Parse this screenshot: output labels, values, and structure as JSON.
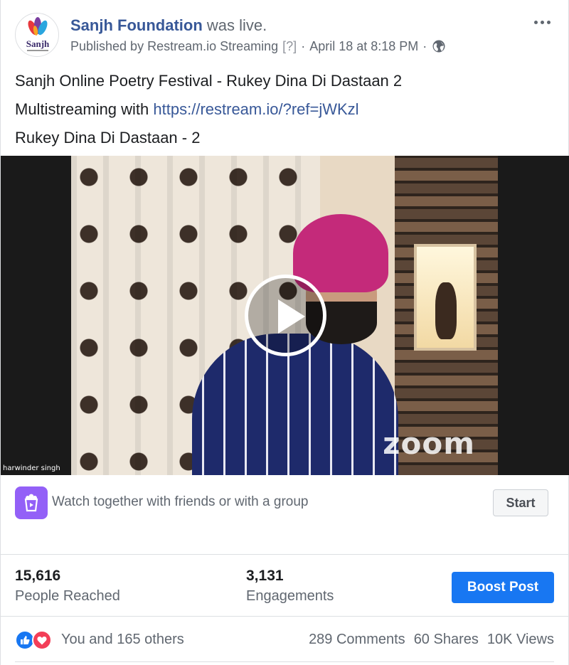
{
  "header": {
    "page_name": "Sanjh Foundation",
    "action": "was live.",
    "published_by": "Published by",
    "publisher_app": "Restream.io Streaming",
    "help": "[?]",
    "timestamp": "April 18 at 8:18 PM",
    "avatar_text": "Sanjh",
    "privacy_icon": "globe-icon",
    "more_icon": "more-options-icon"
  },
  "post": {
    "line1": "Sanjh Online Poetry Festival - Rukey Dina Di Dastaan 2",
    "line2_prefix": "Multistreaming with",
    "link": "https://restream.io/?ref=jWKzl",
    "line3": "Rukey Dina Di Dastaan - 2"
  },
  "video": {
    "participant_label": "harwinder singh",
    "watermark": "zoom",
    "play_icon": "play-icon"
  },
  "watch_together": {
    "text": "Watch together with friends or with a group",
    "button": "Start",
    "icon": "watch-party-icon"
  },
  "insights": {
    "reached_value": "15,616",
    "reached_label": "People Reached",
    "engagements_value": "3,131",
    "engagements_label": "Engagements",
    "boost_button": "Boost Post"
  },
  "reactions": {
    "summary": "You and 165 others",
    "comments": "289 Comments",
    "shares": "60 Shares",
    "views": "10K Views",
    "icons": [
      "like-icon",
      "love-icon"
    ]
  },
  "colors": {
    "link": "#385898",
    "primary_button": "#1877f2",
    "watch_icon_bg": "#9360f7",
    "like": "#1877f2",
    "love": "#f33e58",
    "turban": "#c42a7a"
  }
}
